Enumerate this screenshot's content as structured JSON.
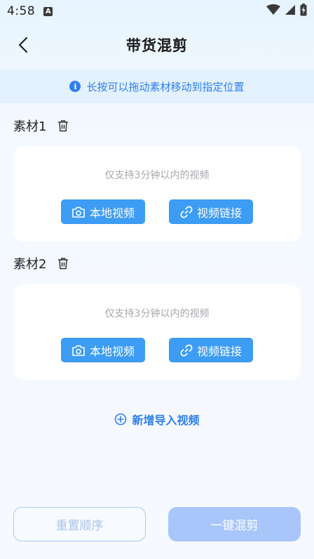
{
  "status_bar": {
    "time": "4:58",
    "indicator": "A",
    "icons": [
      "wifi-icon",
      "signal-icon",
      "battery-charging-icon"
    ]
  },
  "nav": {
    "title": "带货混剪",
    "back_icon": "chevron-left-icon"
  },
  "tip": {
    "icon": "info-icon",
    "icon_glyph": "i",
    "text": "长按可以拖动素材移动到指定位置"
  },
  "materials": [
    {
      "label": "素材1",
      "hint": "仅支持3分钟以内的视频",
      "local_label": "本地视频",
      "link_label": "视频链接"
    },
    {
      "label": "素材2",
      "hint": "仅支持3分钟以内的视频",
      "local_label": "本地视频",
      "link_label": "视频链接"
    }
  ],
  "add_video": {
    "label": "新增导入视频",
    "icon": "plus-circle-icon"
  },
  "footer": {
    "reset_label": "重置顺序",
    "mix_label": "一键混剪"
  },
  "colors": {
    "accent": "#2f7fee",
    "button": "#3d9cf3",
    "tip_bg": "#e3f1fd",
    "disabled_primary": "#a9c6fb"
  }
}
